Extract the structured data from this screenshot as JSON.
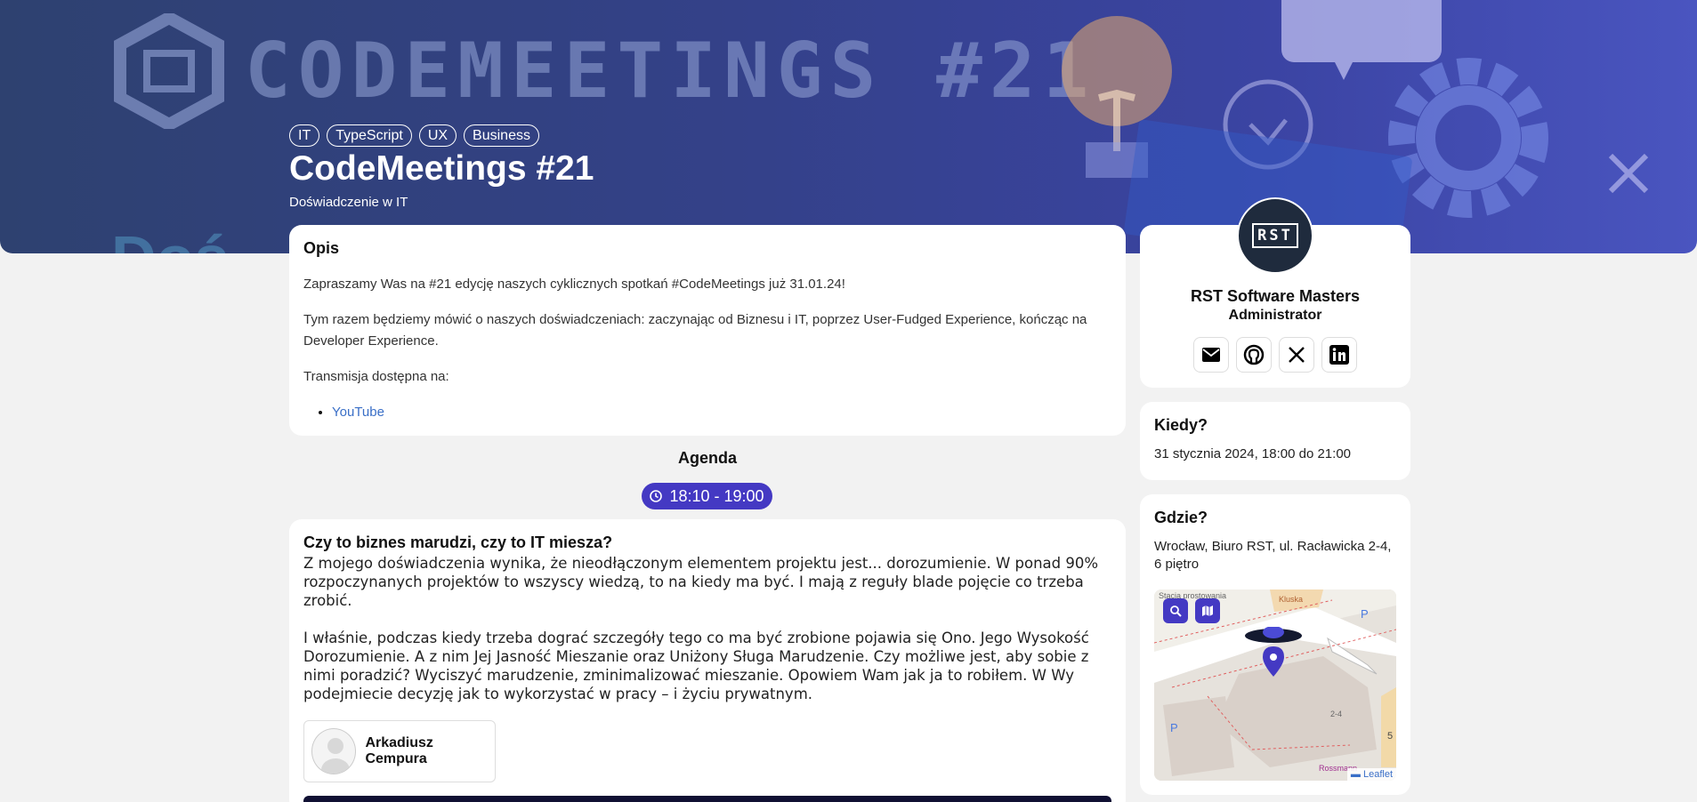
{
  "hero": {
    "banner_text": "CODEMEETINGS #21",
    "tags": [
      "IT",
      "TypeScript",
      "UX",
      "Business"
    ],
    "title": "CodeMeetings #21",
    "subtitle": "Doświadczenie w IT"
  },
  "opis": {
    "heading": "Opis",
    "p1": "Zapraszamy Was na #21 edycję naszych cyklicznych spotkań #CodeMeetings już 31.01.24!",
    "p2": "Tym razem będziemy mówić o naszych doświadczeniach: zaczynając od Biznesu i IT, poprzez User-Fudged Experience, kończąc na Developer Experience.",
    "p3": "Transmisja dostępna na:",
    "link": "YouTube"
  },
  "agenda": {
    "heading": "Agenda",
    "time": "18:10 - 19:00",
    "talk_title": "Czy to biznes marudzi, czy to IT miesza?",
    "talk_p1": "Z mojego doświadczenia wynika, że nieodłączonym elementem projektu jest... dorozumienie. W ponad 90% rozpoczynanych projektów to wszyscy wiedzą, to na kiedy ma być. I mają z reguły blade pojęcie co trzeba zrobić.",
    "talk_p2": "I właśnie, podczas kiedy trzeba dograć szczegóły tego co ma być zrobione pojawia się Ono. Jego Wysokość Dorozumienie. A z nim Jej Jasność Mieszanie oraz Uniżony Sługa Marudzenie. Czy możliwe jest, aby sobie z nimi poradzić? Wyciszyć marudzenie, zminimalizować mieszanie. Opowiem Wam jak ja to robiłem. W Wy podejmiecie decyzję jak to wykorzystać w pracy – i życiu prywatnym.",
    "speaker": "Arkadiusz Cempura"
  },
  "organizer": {
    "logo_text": "RST",
    "name": "RST Software Masters",
    "role": "Administrator"
  },
  "kiedy": {
    "heading": "Kiedy?",
    "value": "31 stycznia 2024, 18:00 do 21:00"
  },
  "gdzie": {
    "heading": "Gdzie?",
    "value": "Wrocław, Biuro RST, ul. Racławicka 2-4, 6 piętro",
    "map_label_1": "Stacja prostowania",
    "map_label_2": "Kluska",
    "map_label_3": "Rossmann",
    "map_number": "2-4",
    "attribution": "Leaflet"
  },
  "colors": {
    "accent": "#4439c3",
    "link": "#3a6fc7",
    "org_logo_bg": "#1f2b3d"
  }
}
